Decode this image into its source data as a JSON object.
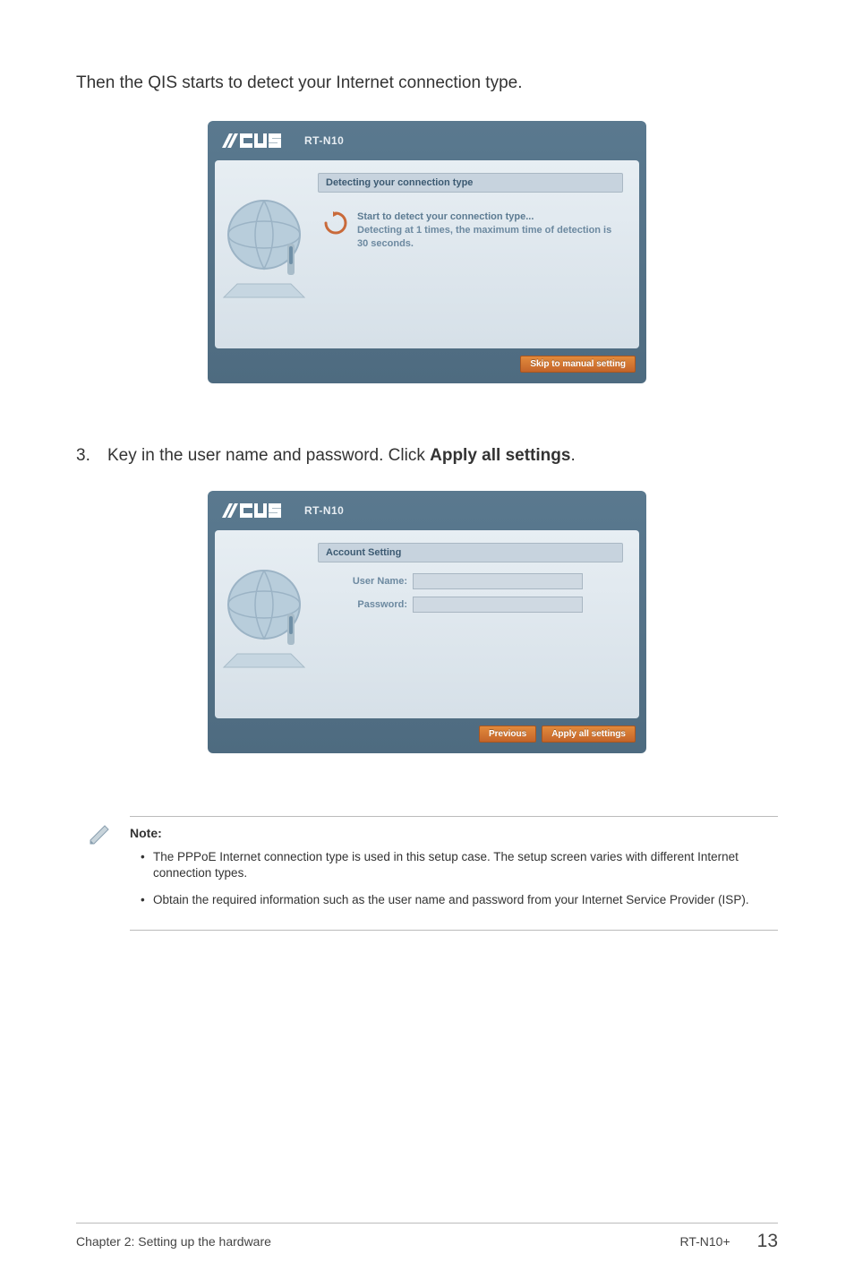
{
  "intro_text": "Then the QIS starts to detect your Internet connection type.",
  "panel1": {
    "product": "RT-N10",
    "tab_label": "Detecting your connection type",
    "line1": "Start to detect your connection type...",
    "line2": "Detecting at 1 times, the maximum time of detection is 30 seconds.",
    "skip_button": "Skip to manual setting"
  },
  "step3": {
    "number": "3.",
    "text_prefix": "Key in the user name and password. Click ",
    "bold": "Apply all settings",
    "suffix": "."
  },
  "panel2": {
    "product": "RT-N10",
    "tab_label": "Account Setting",
    "user_label": "User Name:",
    "password_label": "Password:",
    "previous_button": "Previous",
    "apply_button": "Apply all settings"
  },
  "note": {
    "title": "Note:",
    "items": [
      "The PPPoE Internet connection type is used in this setup case. The setup screen varies with different Internet connection types.",
      "Obtain the required information such as the user name and password from your Internet Service Provider (ISP)."
    ]
  },
  "footer": {
    "left": "Chapter 2: Setting up the hardware",
    "model": "RT-N10+",
    "page": "13"
  }
}
